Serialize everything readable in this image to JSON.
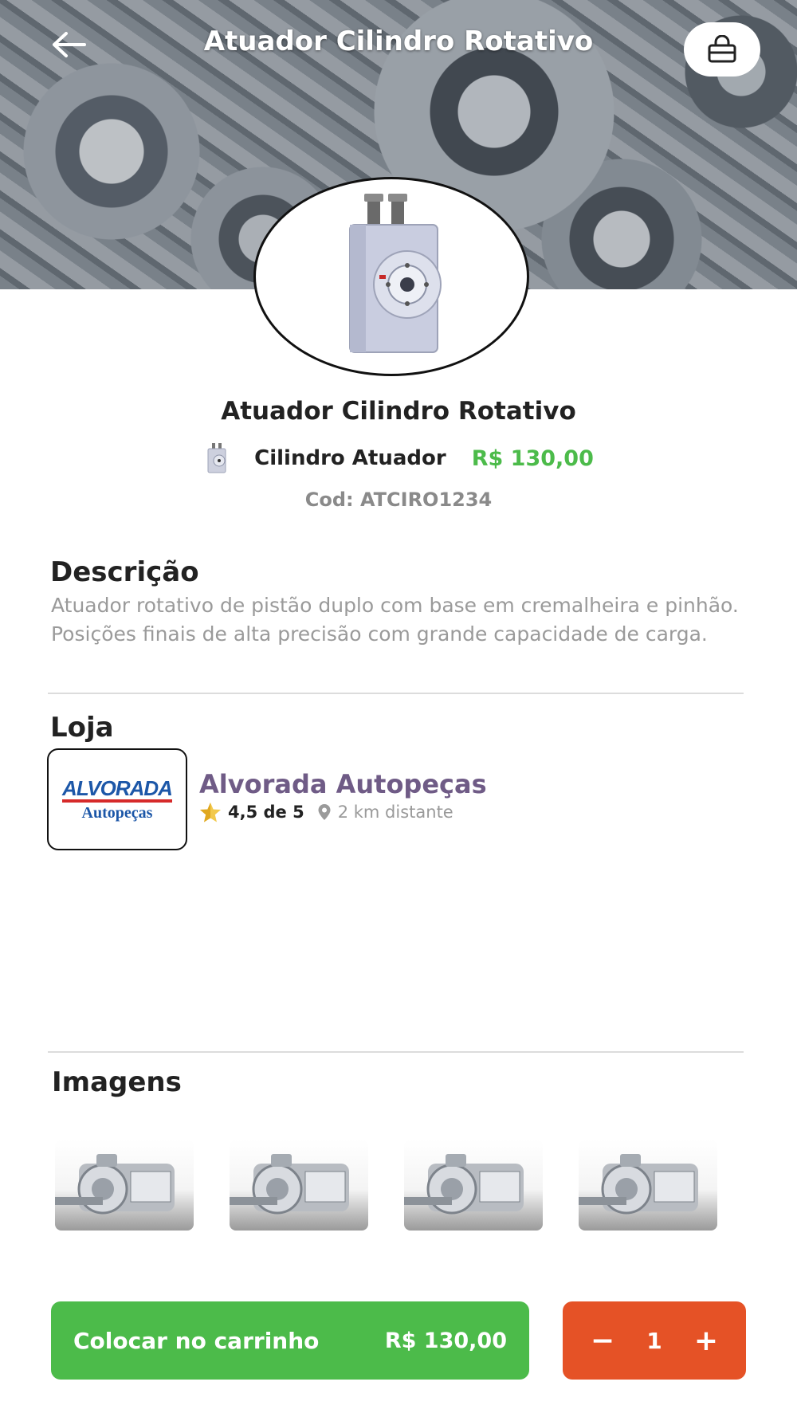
{
  "header": {
    "title": "Atuador Cilindro Rotativo",
    "back_icon": "arrow-left-icon",
    "cart_icon": "shopping-bag-icon"
  },
  "product": {
    "title": "Atuador Cilindro Rotativo",
    "subtitle": "Cilindro Atuador",
    "price": "R$ 130,00",
    "code": "Cod: ATCIRO1234"
  },
  "description": {
    "heading": "Descrição",
    "text": "Atuador rotativo de pistão duplo com base em cremalheira e pinhão. Posições finais de alta precisão com grande capacidade de carga."
  },
  "store": {
    "heading": "Loja",
    "logo_top": "ALVORADA",
    "logo_bottom": "Autopeças",
    "name": "Alvorada Autopeças",
    "rating": "4,5 de 5",
    "distance": "2 km distante"
  },
  "images": {
    "heading": "Imagens",
    "count": 4
  },
  "cart_bar": {
    "add_label": "Colocar no carrinho",
    "add_price": "R$ 130,00",
    "minus_label": "−",
    "quantity": "1",
    "plus_label": "+"
  },
  "colors": {
    "primary_green": "#4cbb4a",
    "accent_orange": "#e55226",
    "store_purple": "#6f5b86"
  }
}
